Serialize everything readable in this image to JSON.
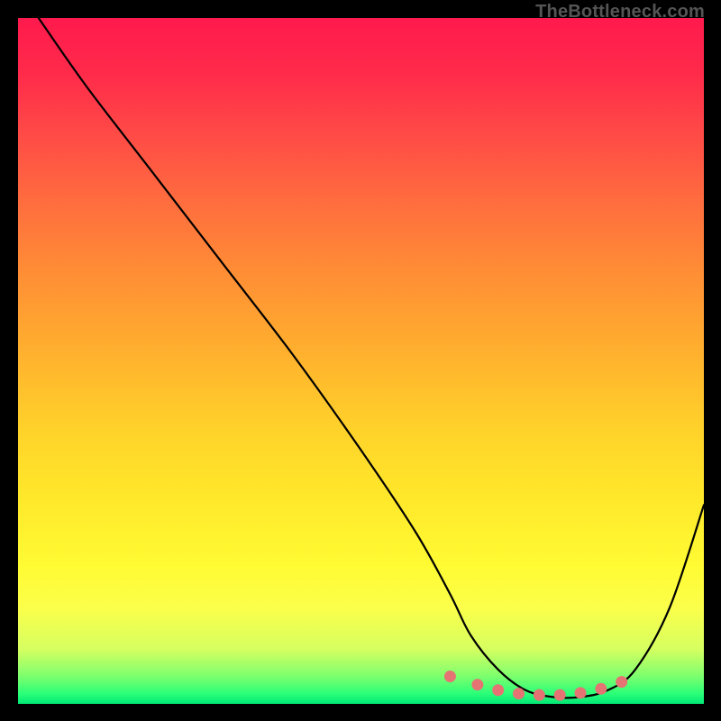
{
  "watermark": "TheBottleneck.com",
  "chart_data": {
    "type": "line",
    "title": "",
    "xlabel": "",
    "ylabel": "",
    "xlim": [
      0,
      100
    ],
    "ylim": [
      0,
      100
    ],
    "series": [
      {
        "name": "bottleneck-curve",
        "x": [
          3,
          10,
          20,
          30,
          40,
          50,
          58,
          63,
          66,
          70,
          74,
          78,
          82,
          86,
          90,
          95,
          100
        ],
        "values": [
          100,
          90,
          77,
          64,
          51,
          37,
          25,
          16,
          10,
          5,
          2,
          1,
          1,
          2,
          5,
          14,
          29
        ]
      }
    ],
    "markers": {
      "name": "bottleneck-markers",
      "x": [
        63,
        67,
        70,
        73,
        76,
        79,
        82,
        85,
        88
      ],
      "values": [
        4.0,
        2.8,
        2.0,
        1.5,
        1.3,
        1.3,
        1.6,
        2.2,
        3.2
      ],
      "color": "#e57373"
    },
    "colors": {
      "curve": "#000000",
      "marker": "#e57373",
      "gradient_top": "#ff1a4d",
      "gradient_bottom": "#00e876"
    }
  }
}
